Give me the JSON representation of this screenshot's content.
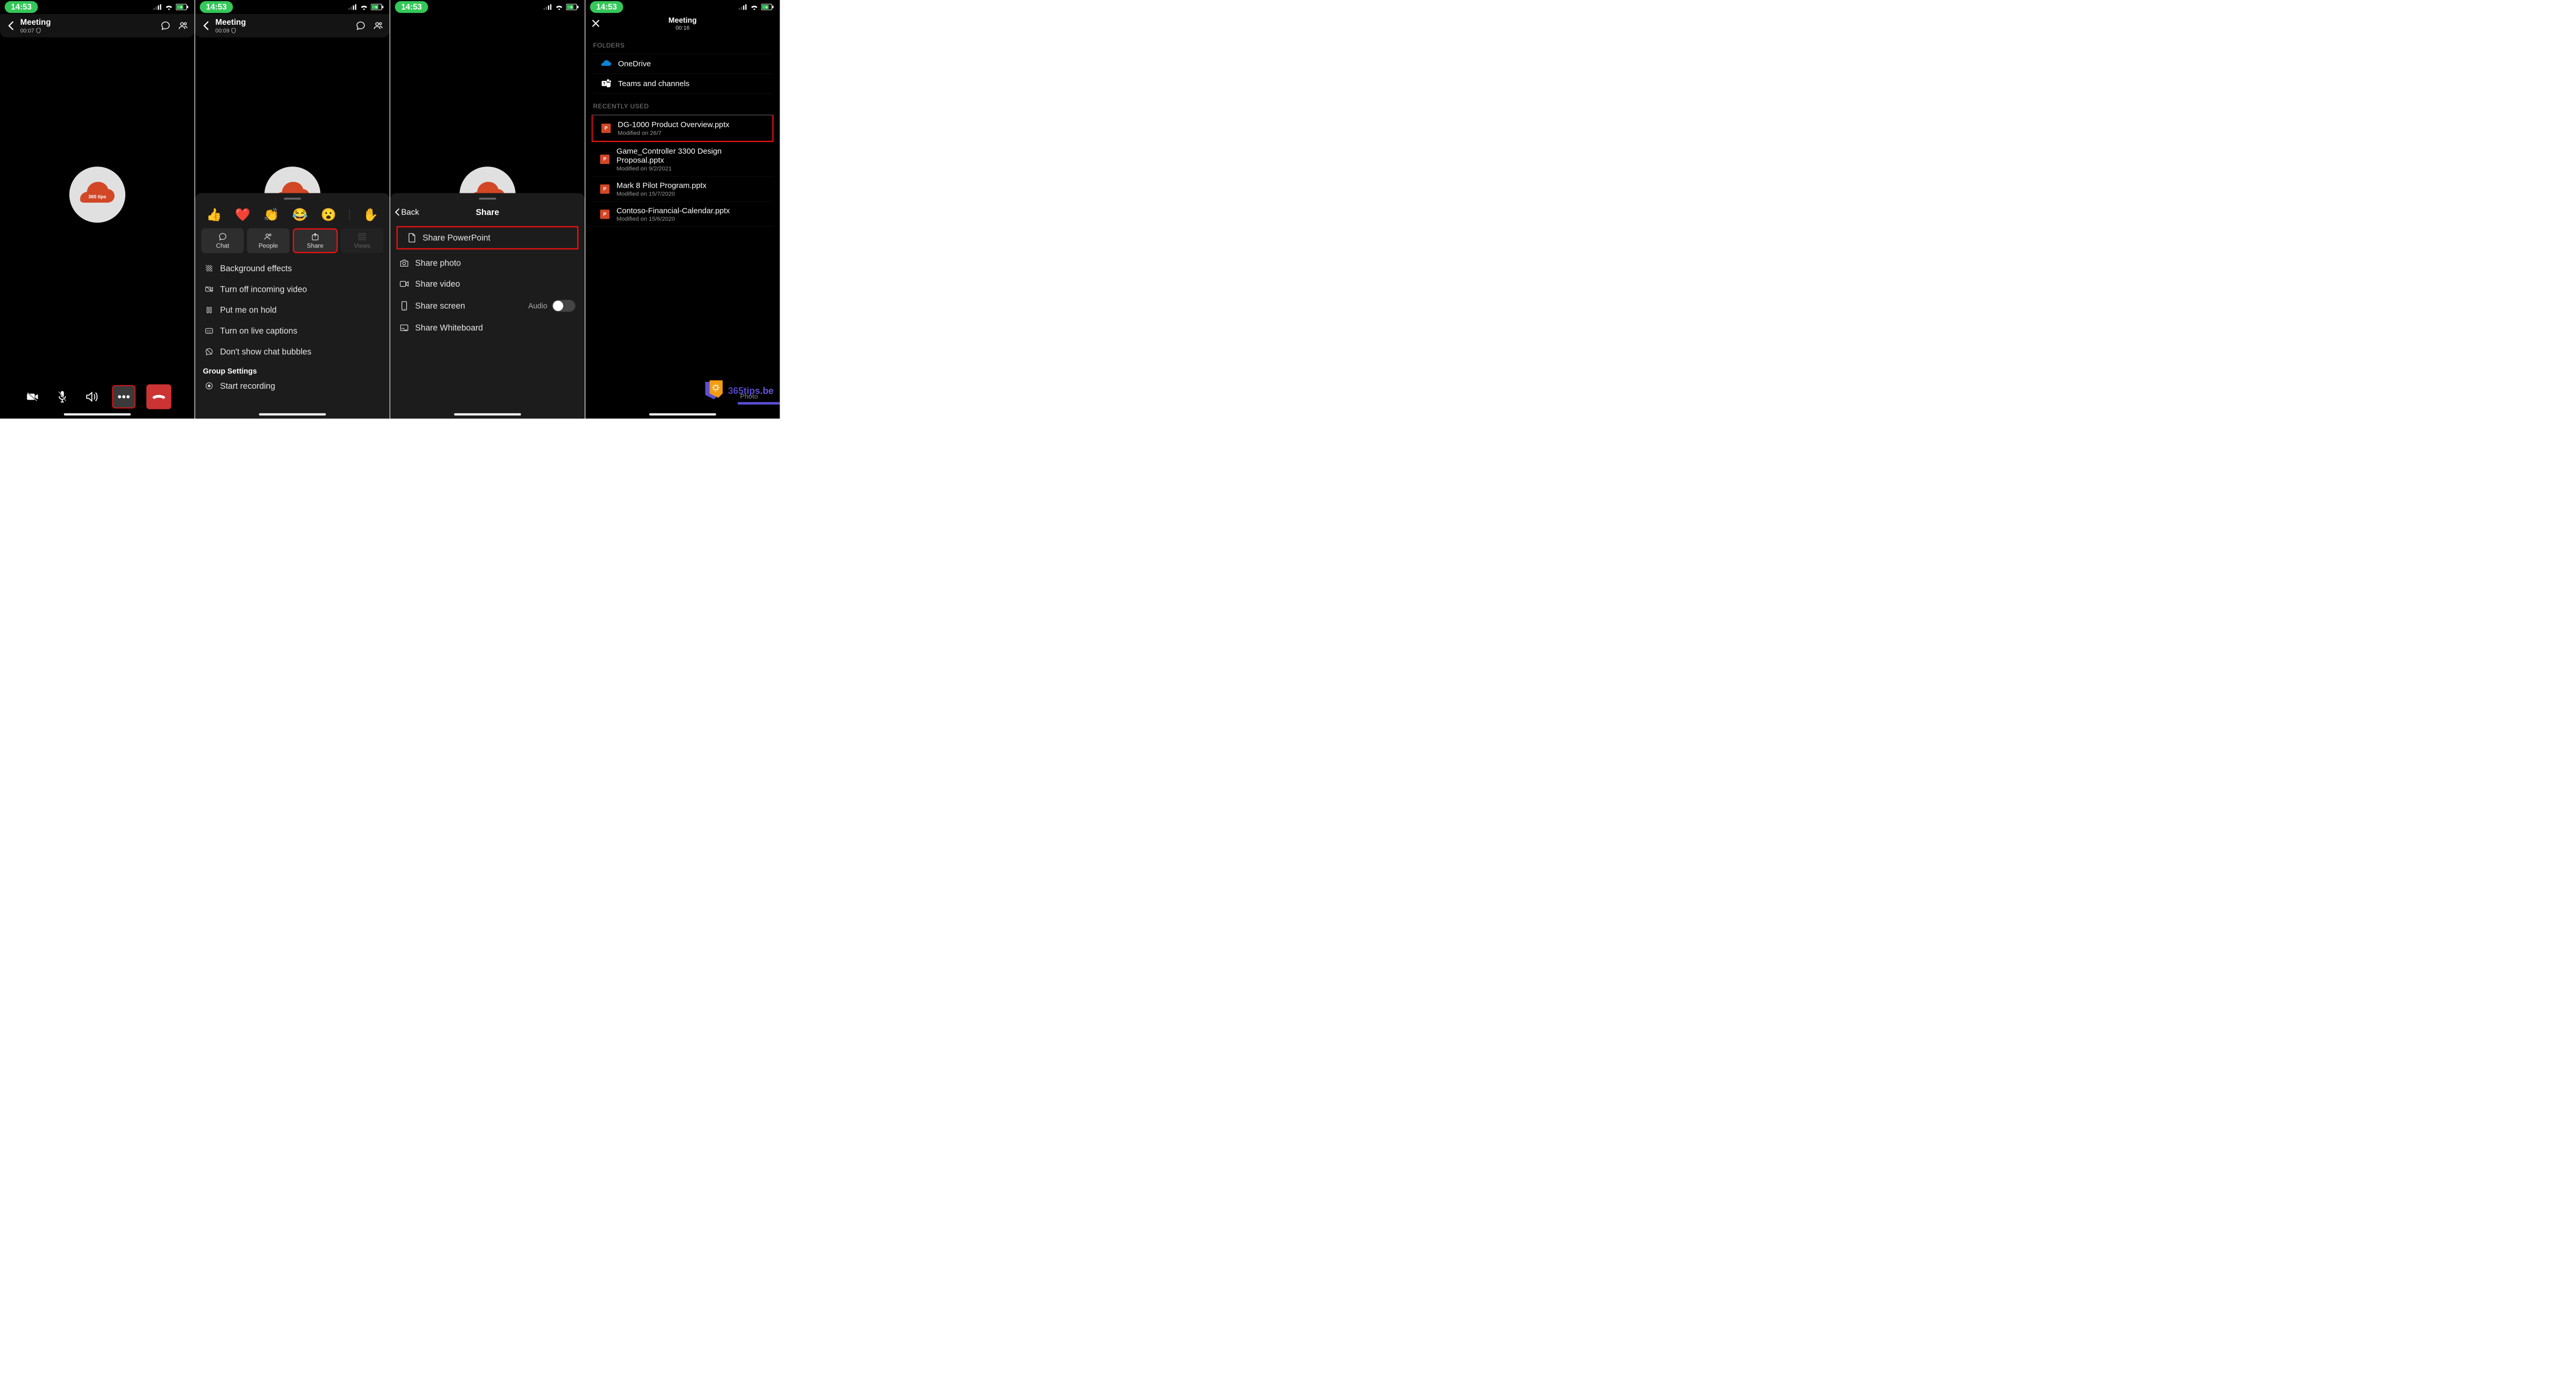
{
  "status_time": "14:53",
  "screen1": {
    "title": "Meeting",
    "timer": "00:07",
    "controls": {
      "camera": "camera-off",
      "mic": "mic-off",
      "speaker": "speaker",
      "more": "…",
      "hangup": "hang-up"
    }
  },
  "screen2": {
    "title": "Meeting",
    "timer": "00:09",
    "reactions": [
      "👍",
      "❤️",
      "👏",
      "😂",
      "😮",
      "✋"
    ],
    "pills": [
      {
        "label": "Chat",
        "icon": "chat"
      },
      {
        "label": "People",
        "icon": "people"
      },
      {
        "label": "Share",
        "icon": "share",
        "highlight": true
      },
      {
        "label": "Views",
        "icon": "views",
        "disabled": true
      }
    ],
    "menu": [
      {
        "label": "Background effects",
        "icon": "bg"
      },
      {
        "label": "Turn off incoming video",
        "icon": "novideo"
      },
      {
        "label": "Put me on hold",
        "icon": "hold"
      },
      {
        "label": "Turn on live captions",
        "icon": "cc"
      },
      {
        "label": "Don't show chat bubbles",
        "icon": "nobubble"
      }
    ],
    "group_heading": "Group Settings",
    "group_items": [
      {
        "label": "Start recording",
        "icon": "record"
      }
    ]
  },
  "screen3": {
    "back_label": "Back",
    "title": "Share",
    "items": [
      {
        "label": "Share PowerPoint",
        "icon": "doc",
        "highlight": true
      },
      {
        "label": "Share photo",
        "icon": "camera"
      },
      {
        "label": "Share video",
        "icon": "video"
      },
      {
        "label": "Share screen",
        "icon": "phone",
        "toggle": true,
        "toggle_label": "Audio"
      },
      {
        "label": "Share Whiteboard",
        "icon": "whiteboard"
      }
    ]
  },
  "screen4": {
    "title": "Meeting",
    "timer": "00:16",
    "folders_heading": "FOLDERS",
    "folders": [
      {
        "label": "OneDrive",
        "icon": "onedrive"
      },
      {
        "label": "Teams and channels",
        "icon": "teams"
      }
    ],
    "recent_heading": "RECENTLY USED",
    "files": [
      {
        "name": "DG-1000 Product Overview.pptx",
        "meta": "Modified on 26/7",
        "highlight": true
      },
      {
        "name": "Game_Controller 3300 Design Proposal.pptx",
        "meta": "Modified on 9/2/2021"
      },
      {
        "name": "Mark 8 Pilot Program.pptx",
        "meta": "Modified on 15/7/2020"
      },
      {
        "name": "Contoso-Financial-Calendar.pptx",
        "meta": "Modified on 15/6/2020"
      }
    ],
    "site_badge": "365tips.be",
    "bottom_label": "Photo"
  }
}
